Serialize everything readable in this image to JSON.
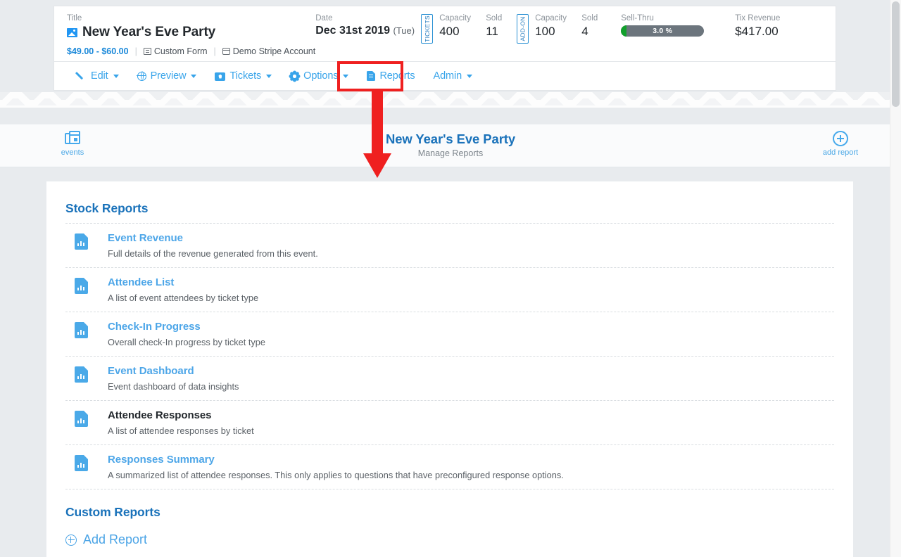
{
  "event_card": {
    "title_label": "Title",
    "title": "New Year's Eve Party",
    "title_icon": "image-icon",
    "price_range": "$49.00 - $60.00",
    "custom_form": "Custom Form",
    "payment_account": "Demo Stripe Account",
    "date_label": "Date",
    "date_value": "Dec 31st 2019",
    "date_dow": "(Tue)",
    "tickets_tag": "TICKETS",
    "tickets_capacity_label": "Capacity",
    "tickets_capacity": "400",
    "tickets_sold_label": "Sold",
    "tickets_sold": "11",
    "addon_tag": "ADD-ON",
    "addon_capacity_label": "Capacity",
    "addon_capacity": "100",
    "addon_sold_label": "Sold",
    "addon_sold": "4",
    "sellthru_label": "Sell-Thru",
    "sellthru_pct": "3.0 %",
    "sellthru_fill_color": "#12a02c",
    "sellthru_track_color": "#6c757d",
    "revenue_label": "Tix Revenue",
    "revenue_value": "$417.00"
  },
  "menu": {
    "items": [
      {
        "label": "Edit",
        "icon": "pencil-icon",
        "caret": true
      },
      {
        "label": "Preview",
        "icon": "globe-icon",
        "caret": true
      },
      {
        "label": "Tickets",
        "icon": "ticket-icon",
        "caret": true
      },
      {
        "label": "Options",
        "icon": "gear-icon",
        "caret": true
      },
      {
        "label": "Reports",
        "icon": "document-icon",
        "caret": false
      },
      {
        "label": "Admin",
        "icon": "none",
        "caret": true
      }
    ],
    "highlight_color": "#ef2020",
    "link_color": "#38a4ea"
  },
  "reports_header": {
    "events_label": "events",
    "events_icon": "calendar-stack-icon",
    "title": "New Year's Eve Party",
    "subtitle": "Manage Reports",
    "add_report_label": "add report",
    "add_report_icon": "plus-circle-icon",
    "title_color": "#1a72ba"
  },
  "stock_section": {
    "heading": "Stock Reports",
    "reports": [
      {
        "name": "Event Revenue",
        "desc": "Full details of the revenue generated from this event.",
        "style": "link"
      },
      {
        "name": "Attendee List",
        "desc": "A list of event attendees by ticket type",
        "style": "link"
      },
      {
        "name": "Check-In Progress",
        "desc": "Overall check-In progress by ticket type",
        "style": "link"
      },
      {
        "name": "Event Dashboard",
        "desc": "Event dashboard of data insights",
        "style": "link"
      },
      {
        "name": "Attendee Responses",
        "desc": "A list of attendee responses by ticket",
        "style": "dark"
      },
      {
        "name": "Responses Summary",
        "desc": "A summarized list of attendee responses. This only applies to questions that have preconfigured response options.",
        "style": "link"
      }
    ]
  },
  "custom_section": {
    "heading": "Custom Reports",
    "add_report_label": "Add Report",
    "add_report_icon": "plus-circle-icon"
  }
}
